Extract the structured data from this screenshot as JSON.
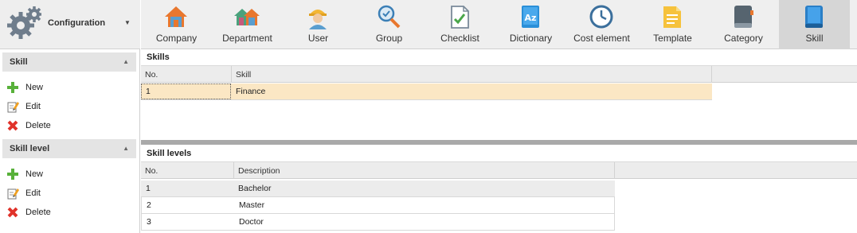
{
  "sidebar": {
    "title": "Configuration",
    "groups": [
      {
        "title": "Skill",
        "actions": [
          {
            "label": "New",
            "icon": "plus-icon"
          },
          {
            "label": "Edit",
            "icon": "edit-icon"
          },
          {
            "label": "Delete",
            "icon": "delete-icon"
          }
        ]
      },
      {
        "title": "Skill level",
        "actions": [
          {
            "label": "New",
            "icon": "plus-icon"
          },
          {
            "label": "Edit",
            "icon": "edit-icon"
          },
          {
            "label": "Delete",
            "icon": "delete-icon"
          }
        ]
      }
    ]
  },
  "toolbar": {
    "items": [
      {
        "label": "Company",
        "icon": "house-icon"
      },
      {
        "label": "Department",
        "icon": "houses-icon"
      },
      {
        "label": "User",
        "icon": "worker-icon"
      },
      {
        "label": "Group",
        "icon": "magnifier-icon"
      },
      {
        "label": "Checklist",
        "icon": "checklist-icon"
      },
      {
        "label": "Dictionary",
        "icon": "dictionary-icon"
      },
      {
        "label": "Cost element",
        "icon": "clock-icon"
      },
      {
        "label": "Template",
        "icon": "template-icon"
      },
      {
        "label": "Category",
        "icon": "book-icon"
      },
      {
        "label": "Skill",
        "icon": "skill-book-icon"
      }
    ],
    "active": "Skill"
  },
  "skills": {
    "title": "Skills",
    "columns": [
      "No.",
      "Skill"
    ],
    "rows": [
      {
        "no": "1",
        "skill": "Finance"
      }
    ]
  },
  "skill_levels": {
    "title": "Skill levels",
    "columns": [
      "No.",
      "Description"
    ],
    "rows": [
      {
        "no": "1",
        "description": "Bachelor"
      },
      {
        "no": "2",
        "description": "Master"
      },
      {
        "no": "3",
        "description": "Doctor"
      }
    ]
  },
  "colors": {
    "selected_row": "#fbe7c4",
    "toolbar_bg": "#efefef",
    "active_tab": "#d6d6d6",
    "splitter": "#a9a9a9"
  }
}
